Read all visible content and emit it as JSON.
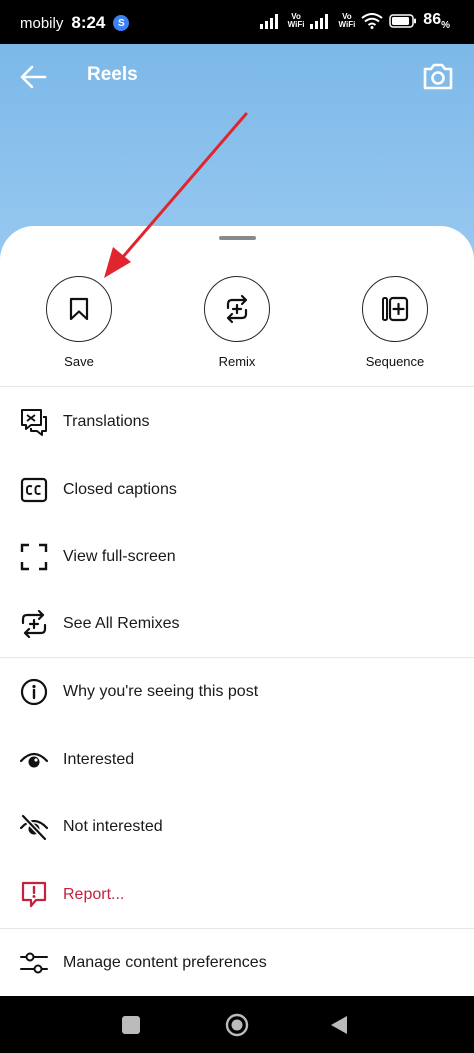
{
  "status_bar": {
    "carrier": "mobily",
    "time": "8:24",
    "app_badge": "S",
    "vowifi_1": [
      "Vo",
      "WiFi"
    ],
    "vowifi_2": [
      "Vo",
      "WiFi"
    ],
    "battery": "86",
    "battery_unit": "%"
  },
  "header": {
    "title": "Reels",
    "back_icon": "arrow-left-icon",
    "camera_icon": "camera-icon"
  },
  "actions": [
    {
      "label": "Save",
      "icon": "bookmark-icon"
    },
    {
      "label": "Remix",
      "icon": "remix-icon"
    },
    {
      "label": "Sequence",
      "icon": "sequence-icon"
    }
  ],
  "menu": [
    {
      "label": "Translations",
      "icon": "translate-icon"
    },
    {
      "label": "Closed captions",
      "icon": "closed-captions-icon"
    },
    {
      "label": "View full-screen",
      "icon": "fullscreen-icon"
    },
    {
      "label": "See All Remixes",
      "icon": "remix-icon"
    },
    {
      "label": "Why you're seeing this post",
      "icon": "info-icon"
    },
    {
      "label": "Interested",
      "icon": "eye-icon"
    },
    {
      "label": "Not interested",
      "icon": "eye-off-icon"
    },
    {
      "label": "Report...",
      "icon": "report-icon",
      "color": "#c4223f"
    },
    {
      "label": "Manage content preferences",
      "icon": "sliders-icon"
    }
  ],
  "colors": {
    "danger": "#c4223f",
    "annotation_arrow": "#e0252e",
    "video_sky": "#8ec3ee"
  },
  "nav": {
    "recents": "square-icon",
    "home": "circle-home-icon",
    "back": "triangle-back-icon"
  }
}
